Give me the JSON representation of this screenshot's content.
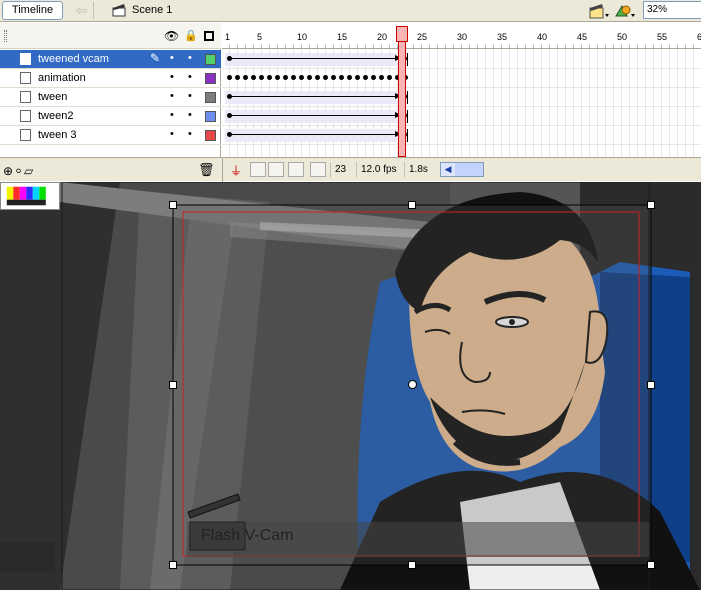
{
  "toolbar": {
    "timeline_label": "Timeline",
    "scene_label": "Scene 1",
    "zoom_value": "32%",
    "icons": [
      "back-arrow-icon",
      "scene-icon",
      "edit-symbols-icon",
      "edit-scene-icon"
    ]
  },
  "timeline": {
    "ruler_numbers": [
      "1",
      "5",
      "10",
      "15",
      "20",
      "25",
      "30",
      "35",
      "40",
      "45",
      "50",
      "55",
      "6"
    ],
    "current_frame": 23,
    "layers": [
      {
        "name": "tweened vcam",
        "selected": true,
        "color": "#4fd16b",
        "content": "tween"
      },
      {
        "name": "animation",
        "selected": false,
        "color": "#8a33c4",
        "content": "keyframes"
      },
      {
        "name": "tween",
        "selected": false,
        "color": "#7d7d7d",
        "content": "tween"
      },
      {
        "name": "tween2",
        "selected": false,
        "color": "#6f8ff0",
        "content": "tween"
      },
      {
        "name": "tween 3",
        "selected": false,
        "color": "#e84848",
        "content": "tween"
      }
    ],
    "footer": {
      "frame": "23",
      "fps": "12.0 fps",
      "time": "1.8s"
    }
  },
  "stage": {
    "vcam_label": "Flash V-Cam"
  },
  "colors": {
    "accent": "#316ac5",
    "playhead": "#cc0000",
    "stage_bg": "#3e3e3e",
    "skin": "#f2c79a",
    "seat_blue": "#1c5cb8"
  }
}
